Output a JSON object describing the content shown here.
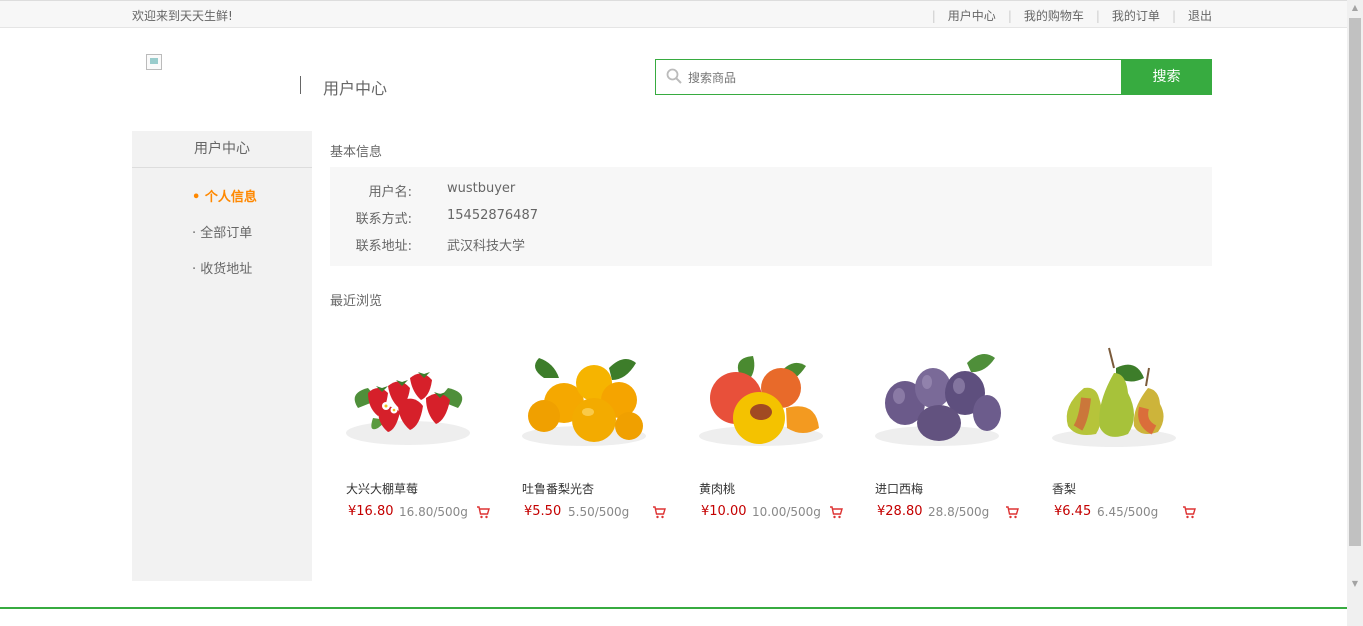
{
  "topbar": {
    "welcome": "欢迎来到天天生鲜!",
    "links": [
      "用户中心",
      "我的购物车",
      "我的订单",
      "退出"
    ]
  },
  "header": {
    "page_title": "用户中心",
    "search_placeholder": "搜索商品",
    "search_button": "搜索"
  },
  "sidebar": {
    "title": "用户中心",
    "items": [
      {
        "label": "• 个人信息",
        "active": true
      },
      {
        "label": "· 全部订单",
        "active": false
      },
      {
        "label": "· 收货地址",
        "active": false
      }
    ]
  },
  "info": {
    "title": "基本信息",
    "rows": [
      {
        "label": "用户名:",
        "value": "wustbuyer"
      },
      {
        "label": "联系方式:",
        "value": "15452876487"
      },
      {
        "label": "联系地址:",
        "value": "武汉科技大学"
      }
    ]
  },
  "recent": {
    "title": "最近浏览",
    "products": [
      {
        "name": "大兴大棚草莓",
        "price": "¥16.80",
        "unit": "16.80/500g",
        "icon": "strawberry-image"
      },
      {
        "name": "吐鲁番梨光杏",
        "price": "¥5.50",
        "unit": "5.50/500g",
        "icon": "apricot-image"
      },
      {
        "name": "黄肉桃",
        "price": "¥10.00",
        "unit": "10.00/500g",
        "icon": "peach-image"
      },
      {
        "name": "进口西梅",
        "price": "¥28.80",
        "unit": "28.8/500g",
        "icon": "plum-image"
      },
      {
        "name": "香梨",
        "price": "¥6.45",
        "unit": "6.45/500g",
        "icon": "pear-image"
      }
    ]
  },
  "colors": {
    "brand_green": "#37ab40",
    "active_orange": "#ff8800",
    "price_red": "#c40000"
  }
}
